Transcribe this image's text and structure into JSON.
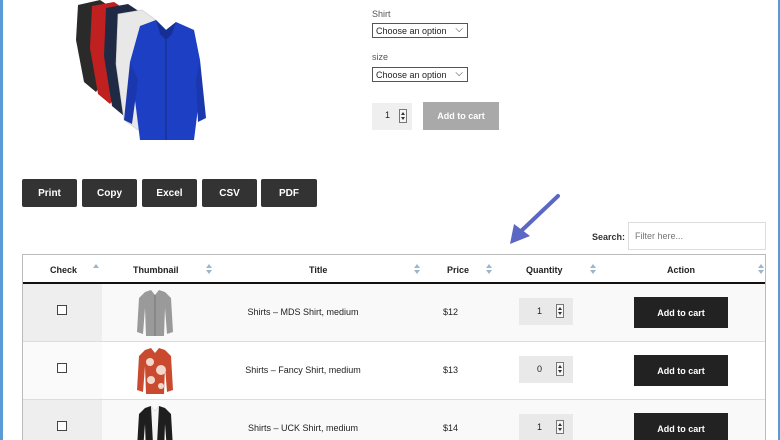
{
  "product": {
    "variation_1": {
      "label": "Shirt",
      "selected": "Choose an option"
    },
    "variation_2": {
      "label": "size",
      "selected": "Choose an option"
    },
    "quantity": "1",
    "add_to_cart": "Add to cart"
  },
  "export_buttons": [
    "Print",
    "Copy",
    "Excel",
    "CSV",
    "PDF"
  ],
  "search": {
    "label": "Search:",
    "placeholder": "Filter here..."
  },
  "table": {
    "headers": [
      "Check",
      "Thumbnail",
      "Title",
      "Price",
      "Quantity",
      "Action"
    ],
    "rows": [
      {
        "title": "Shirts – MDS Shirt, medium",
        "price": "$12",
        "quantity": "1",
        "action": "Add to cart"
      },
      {
        "title": "Shirts – Fancy Shirt, medium",
        "price": "$13",
        "quantity": "0",
        "action": "Add to cart"
      },
      {
        "title": "Shirts – UCK Shirt, medium",
        "price": "$14",
        "quantity": "1",
        "action": "Add to cart"
      }
    ]
  },
  "colors": {
    "frame": "#5b9bd5",
    "button_dark": "#333333",
    "button_grey": "#a9a9a9",
    "arrow": "#5a67c4"
  }
}
